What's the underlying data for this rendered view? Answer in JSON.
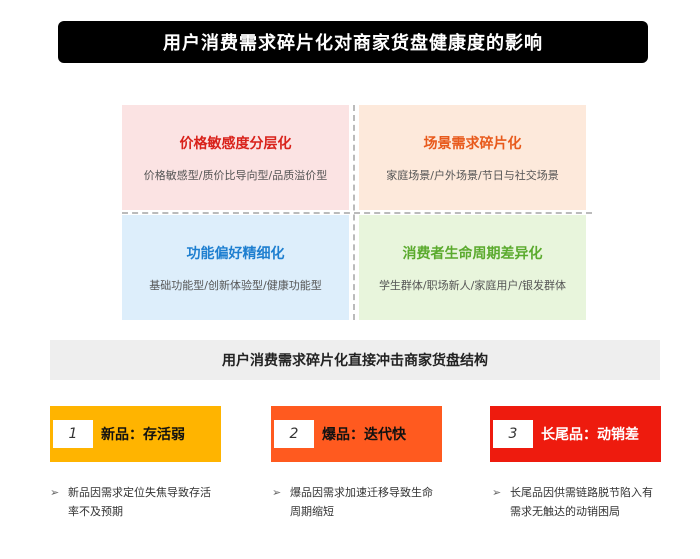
{
  "title": "用户消费需求碎片化对商家货盘健康度的影响",
  "quadrants": [
    {
      "title": "价格敏感度分层化",
      "subtitle": "价格敏感型/质价比导向型/品质溢价型",
      "color": "#d9221b"
    },
    {
      "title": "场景需求碎片化",
      "subtitle": "家庭场景/户外场景/节日与社交场景",
      "color": "#e85a1c"
    },
    {
      "title": "功能偏好精细化",
      "subtitle": "基础功能型/创新体验型/健康功能型",
      "color": "#1e7fd0"
    },
    {
      "title": "消费者生命周期差异化",
      "subtitle": "学生群体/职场新人/家庭用户/银发群体",
      "color": "#5aaa2d"
    }
  ],
  "impact_bar": "用户消费需求碎片化直接冲击商家货盘结构",
  "impacts": [
    {
      "number": "1",
      "label": "新品：存活弱",
      "color": "#ffb400",
      "arrow": "➢",
      "description": "新品因需求定位失焦导致存活率不及预期"
    },
    {
      "number": "2",
      "label": "爆品：迭代快",
      "color": "#ff5a1f",
      "arrow": "➢",
      "description": "爆品因需求加速迁移导致生命周期缩短"
    },
    {
      "number": "3",
      "label": "长尾品：动销差",
      "color": "#ee1b0e",
      "arrow": "➢",
      "description": "长尾品因供需链路脱节陷入有需求无触达的动销困局"
    }
  ]
}
